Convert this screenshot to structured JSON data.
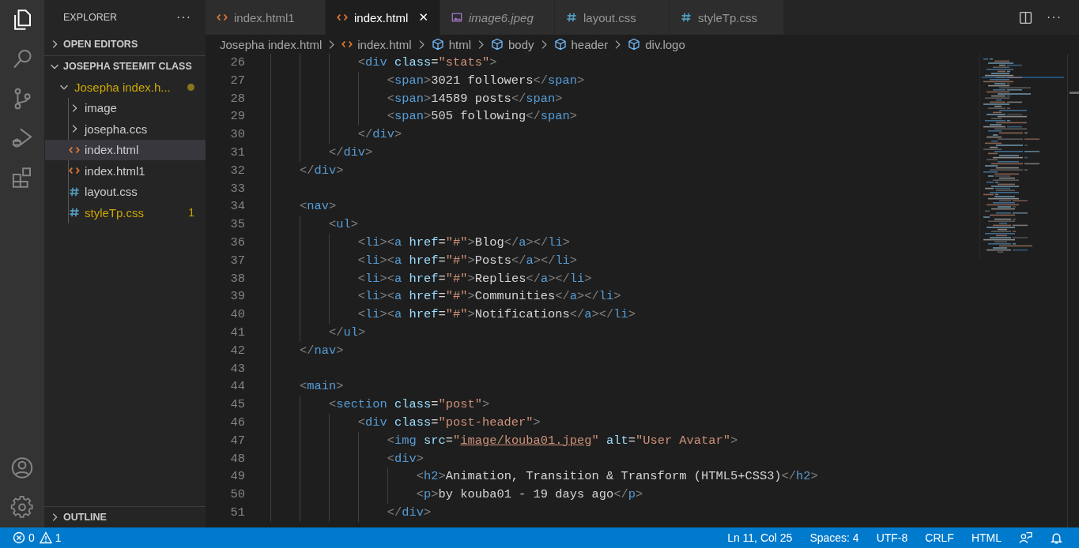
{
  "activity_bar": {
    "items": [
      {
        "kind": "explorer",
        "selected": true
      },
      {
        "kind": "search",
        "selected": false
      },
      {
        "kind": "scm",
        "selected": false
      },
      {
        "kind": "debug",
        "selected": false
      },
      {
        "kind": "extensions",
        "selected": false
      }
    ],
    "bottom": [
      {
        "kind": "account"
      },
      {
        "kind": "settings"
      }
    ]
  },
  "sidebar": {
    "title": "EXPLORER",
    "more": "···",
    "sections": [
      {
        "label": "OPEN EDITORS",
        "expanded": false
      },
      {
        "label": "JOSEPHA STEEMIT CLASS",
        "expanded": true
      }
    ],
    "tree": [
      {
        "label": "Josepha index.h...",
        "kind": "folder",
        "expanded": true,
        "modified": true,
        "selected": false,
        "children": [
          {
            "label": "image",
            "kind": "folder",
            "expanded": false,
            "modified": false,
            "selected": false
          },
          {
            "label": "josepha.ccs",
            "kind": "folder",
            "expanded": false,
            "modified": false,
            "selected": false
          },
          {
            "label": "index.html",
            "kind": "html",
            "modified": false,
            "selected": true
          },
          {
            "label": "index.html1",
            "kind": "html",
            "modified": false,
            "selected": false
          },
          {
            "label": "layout.css",
            "kind": "css",
            "modified": false,
            "selected": false
          },
          {
            "label": "styleTp.css",
            "kind": "css",
            "modified": true,
            "selected": false,
            "badge": "1"
          }
        ]
      }
    ],
    "outline": {
      "label": "OUTLINE",
      "expanded": false
    }
  },
  "tabs": [
    {
      "label": "index.html1",
      "kind": "html",
      "selected": false,
      "preview": false
    },
    {
      "label": "index.html",
      "kind": "html",
      "selected": true,
      "preview": false,
      "close": "✕"
    },
    {
      "label": "image6.jpeg",
      "kind": "image",
      "selected": false,
      "preview": true
    },
    {
      "label": "layout.css",
      "kind": "css",
      "selected": false,
      "preview": false
    },
    {
      "label": "styleTp.css",
      "kind": "css",
      "selected": false,
      "preview": false
    }
  ],
  "tab_actions": {
    "more": "···"
  },
  "breadcrumbs": [
    {
      "label": "Josepha index.html",
      "kind": "folder"
    },
    {
      "label": "index.html",
      "kind": "html"
    },
    {
      "label": "html",
      "kind": "element"
    },
    {
      "label": "body",
      "kind": "element"
    },
    {
      "label": "header",
      "kind": "element"
    },
    {
      "label": "div.logo",
      "kind": "element"
    }
  ],
  "editor": {
    "lines": [
      {
        "number": "26",
        "tokens": [
          {
            "kind": "p",
            "text": "            <"
          },
          {
            "kind": "tag",
            "text": "div"
          },
          {
            "kind": "attr",
            "text": " class"
          },
          {
            "kind": "text",
            "text": "="
          },
          {
            "kind": "str",
            "text": "\"stats\""
          },
          {
            "kind": "p",
            "text": ">"
          }
        ]
      },
      {
        "number": "27",
        "tokens": [
          {
            "kind": "p",
            "text": "                <"
          },
          {
            "kind": "tag",
            "text": "span"
          },
          {
            "kind": "p",
            "text": ">"
          },
          {
            "kind": "text",
            "text": "3021 followers"
          },
          {
            "kind": "p",
            "text": "</"
          },
          {
            "kind": "tag",
            "text": "span"
          },
          {
            "kind": "p",
            "text": ">"
          }
        ]
      },
      {
        "number": "28",
        "tokens": [
          {
            "kind": "p",
            "text": "                <"
          },
          {
            "kind": "tag",
            "text": "span"
          },
          {
            "kind": "p",
            "text": ">"
          },
          {
            "kind": "text",
            "text": "14589 posts"
          },
          {
            "kind": "p",
            "text": "</"
          },
          {
            "kind": "tag",
            "text": "span"
          },
          {
            "kind": "p",
            "text": ">"
          }
        ]
      },
      {
        "number": "29",
        "tokens": [
          {
            "kind": "p",
            "text": "                <"
          },
          {
            "kind": "tag",
            "text": "span"
          },
          {
            "kind": "p",
            "text": ">"
          },
          {
            "kind": "text",
            "text": "505 following"
          },
          {
            "kind": "p",
            "text": "</"
          },
          {
            "kind": "tag",
            "text": "span"
          },
          {
            "kind": "p",
            "text": ">"
          }
        ]
      },
      {
        "number": "30",
        "tokens": [
          {
            "kind": "p",
            "text": "            </"
          },
          {
            "kind": "tag",
            "text": "div"
          },
          {
            "kind": "p",
            "text": ">"
          }
        ]
      },
      {
        "number": "31",
        "tokens": [
          {
            "kind": "p",
            "text": "        </"
          },
          {
            "kind": "tag",
            "text": "div"
          },
          {
            "kind": "p",
            "text": ">"
          }
        ]
      },
      {
        "number": "32",
        "tokens": [
          {
            "kind": "p",
            "text": "    </"
          },
          {
            "kind": "tag",
            "text": "div"
          },
          {
            "kind": "p",
            "text": ">"
          }
        ]
      },
      {
        "number": "33"
      },
      {
        "number": "34",
        "tokens": [
          {
            "kind": "p",
            "text": "    <"
          },
          {
            "kind": "tag",
            "text": "nav"
          },
          {
            "kind": "p",
            "text": ">"
          }
        ]
      },
      {
        "number": "35",
        "tokens": [
          {
            "kind": "p",
            "text": "        <"
          },
          {
            "kind": "tag",
            "text": "ul"
          },
          {
            "kind": "p",
            "text": ">"
          }
        ]
      },
      {
        "number": "36",
        "tokens": [
          {
            "kind": "p",
            "text": "            <"
          },
          {
            "kind": "tag",
            "text": "li"
          },
          {
            "kind": "p",
            "text": "><"
          },
          {
            "kind": "tag",
            "text": "a"
          },
          {
            "kind": "attr",
            "text": " href"
          },
          {
            "kind": "text",
            "text": "="
          },
          {
            "kind": "str",
            "text": "\"#\""
          },
          {
            "kind": "p",
            "text": ">"
          },
          {
            "kind": "text",
            "text": "Blog"
          },
          {
            "kind": "p",
            "text": "</"
          },
          {
            "kind": "tag",
            "text": "a"
          },
          {
            "kind": "p",
            "text": "></"
          },
          {
            "kind": "tag",
            "text": "li"
          },
          {
            "kind": "p",
            "text": ">"
          }
        ]
      },
      {
        "number": "37",
        "tokens": [
          {
            "kind": "p",
            "text": "            <"
          },
          {
            "kind": "tag",
            "text": "li"
          },
          {
            "kind": "p",
            "text": "><"
          },
          {
            "kind": "tag",
            "text": "a"
          },
          {
            "kind": "attr",
            "text": " href"
          },
          {
            "kind": "text",
            "text": "="
          },
          {
            "kind": "str",
            "text": "\"#\""
          },
          {
            "kind": "p",
            "text": ">"
          },
          {
            "kind": "text",
            "text": "Posts"
          },
          {
            "kind": "p",
            "text": "</"
          },
          {
            "kind": "tag",
            "text": "a"
          },
          {
            "kind": "p",
            "text": "></"
          },
          {
            "kind": "tag",
            "text": "li"
          },
          {
            "kind": "p",
            "text": ">"
          }
        ]
      },
      {
        "number": "38",
        "tokens": [
          {
            "kind": "p",
            "text": "            <"
          },
          {
            "kind": "tag",
            "text": "li"
          },
          {
            "kind": "p",
            "text": "><"
          },
          {
            "kind": "tag",
            "text": "a"
          },
          {
            "kind": "attr",
            "text": " href"
          },
          {
            "kind": "text",
            "text": "="
          },
          {
            "kind": "str",
            "text": "\"#\""
          },
          {
            "kind": "p",
            "text": ">"
          },
          {
            "kind": "text",
            "text": "Replies"
          },
          {
            "kind": "p",
            "text": "</"
          },
          {
            "kind": "tag",
            "text": "a"
          },
          {
            "kind": "p",
            "text": "></"
          },
          {
            "kind": "tag",
            "text": "li"
          },
          {
            "kind": "p",
            "text": ">"
          }
        ]
      },
      {
        "number": "39",
        "tokens": [
          {
            "kind": "p",
            "text": "            <"
          },
          {
            "kind": "tag",
            "text": "li"
          },
          {
            "kind": "p",
            "text": "><"
          },
          {
            "kind": "tag",
            "text": "a"
          },
          {
            "kind": "attr",
            "text": " href"
          },
          {
            "kind": "text",
            "text": "="
          },
          {
            "kind": "str",
            "text": "\"#\""
          },
          {
            "kind": "p",
            "text": ">"
          },
          {
            "kind": "text",
            "text": "Communities"
          },
          {
            "kind": "p",
            "text": "</"
          },
          {
            "kind": "tag",
            "text": "a"
          },
          {
            "kind": "p",
            "text": "></"
          },
          {
            "kind": "tag",
            "text": "li"
          },
          {
            "kind": "p",
            "text": ">"
          }
        ]
      },
      {
        "number": "40",
        "tokens": [
          {
            "kind": "p",
            "text": "            <"
          },
          {
            "kind": "tag",
            "text": "li"
          },
          {
            "kind": "p",
            "text": "><"
          },
          {
            "kind": "tag",
            "text": "a"
          },
          {
            "kind": "attr",
            "text": " href"
          },
          {
            "kind": "text",
            "text": "="
          },
          {
            "kind": "str",
            "text": "\"#\""
          },
          {
            "kind": "p",
            "text": ">"
          },
          {
            "kind": "text",
            "text": "Notifications"
          },
          {
            "kind": "p",
            "text": "</"
          },
          {
            "kind": "tag",
            "text": "a"
          },
          {
            "kind": "p",
            "text": "></"
          },
          {
            "kind": "tag",
            "text": "li"
          },
          {
            "kind": "p",
            "text": ">"
          }
        ]
      },
      {
        "number": "41",
        "tokens": [
          {
            "kind": "p",
            "text": "        </"
          },
          {
            "kind": "tag",
            "text": "ul"
          },
          {
            "kind": "p",
            "text": ">"
          }
        ]
      },
      {
        "number": "42",
        "tokens": [
          {
            "kind": "p",
            "text": "    </"
          },
          {
            "kind": "tag",
            "text": "nav"
          },
          {
            "kind": "p",
            "text": ">"
          }
        ]
      },
      {
        "number": "43"
      },
      {
        "number": "44",
        "tokens": [
          {
            "kind": "p",
            "text": "    <"
          },
          {
            "kind": "tag",
            "text": "main"
          },
          {
            "kind": "p",
            "text": ">"
          }
        ]
      },
      {
        "number": "45",
        "tokens": [
          {
            "kind": "p",
            "text": "        <"
          },
          {
            "kind": "tag",
            "text": "section"
          },
          {
            "kind": "attr",
            "text": " class"
          },
          {
            "kind": "text",
            "text": "="
          },
          {
            "kind": "str",
            "text": "\"post\""
          },
          {
            "kind": "p",
            "text": ">"
          }
        ]
      },
      {
        "number": "46",
        "tokens": [
          {
            "kind": "p",
            "text": "            <"
          },
          {
            "kind": "tag",
            "text": "div"
          },
          {
            "kind": "attr",
            "text": " class"
          },
          {
            "kind": "text",
            "text": "="
          },
          {
            "kind": "str",
            "text": "\"post-header\""
          },
          {
            "kind": "p",
            "text": ">"
          }
        ]
      },
      {
        "number": "47",
        "tokens": [
          {
            "kind": "p",
            "text": "                <"
          },
          {
            "kind": "tag",
            "text": "img"
          },
          {
            "kind": "attr",
            "text": " src"
          },
          {
            "kind": "text",
            "text": "="
          },
          {
            "kind": "str",
            "text": "\""
          },
          {
            "kind": "link",
            "text": "image/kouba01.jpeg"
          },
          {
            "kind": "str",
            "text": "\""
          },
          {
            "kind": "attr",
            "text": " alt"
          },
          {
            "kind": "text",
            "text": "="
          },
          {
            "kind": "str",
            "text": "\"User Avatar\""
          },
          {
            "kind": "p",
            "text": ">"
          }
        ]
      },
      {
        "number": "48",
        "tokens": [
          {
            "kind": "p",
            "text": "                <"
          },
          {
            "kind": "tag",
            "text": "div"
          },
          {
            "kind": "p",
            "text": ">"
          }
        ]
      },
      {
        "number": "49",
        "tokens": [
          {
            "kind": "p",
            "text": "                    <"
          },
          {
            "kind": "tag",
            "text": "h2"
          },
          {
            "kind": "p",
            "text": ">"
          },
          {
            "kind": "text",
            "text": "Animation, Transition & Transform (HTML5+CSS3)"
          },
          {
            "kind": "p",
            "text": "</"
          },
          {
            "kind": "tag",
            "text": "h2"
          },
          {
            "kind": "p",
            "text": ">"
          }
        ]
      },
      {
        "number": "50",
        "tokens": [
          {
            "kind": "p",
            "text": "                    <"
          },
          {
            "kind": "tag",
            "text": "p"
          },
          {
            "kind": "p",
            "text": ">"
          },
          {
            "kind": "text",
            "text": "by kouba01 - 19 days ago"
          },
          {
            "kind": "p",
            "text": "</"
          },
          {
            "kind": "tag",
            "text": "p"
          },
          {
            "kind": "p",
            "text": ">"
          }
        ]
      },
      {
        "number": "51",
        "tokens": [
          {
            "kind": "p",
            "text": "                </"
          },
          {
            "kind": "tag",
            "text": "div"
          },
          {
            "kind": "p",
            "text": ">"
          }
        ]
      }
    ]
  },
  "status_bar": {
    "left": [
      {
        "kind": "error",
        "text": "0"
      },
      {
        "kind": "warning",
        "text": "1"
      }
    ],
    "right": [
      {
        "kind": "text",
        "text": "Ln 11, Col 25"
      },
      {
        "kind": "text",
        "text": "Spaces: 4"
      },
      {
        "kind": "text",
        "text": "UTF-8"
      },
      {
        "kind": "text",
        "text": "CRLF"
      },
      {
        "kind": "text",
        "text": "HTML"
      },
      {
        "kind": "feedback"
      },
      {
        "kind": "bell"
      }
    ]
  }
}
